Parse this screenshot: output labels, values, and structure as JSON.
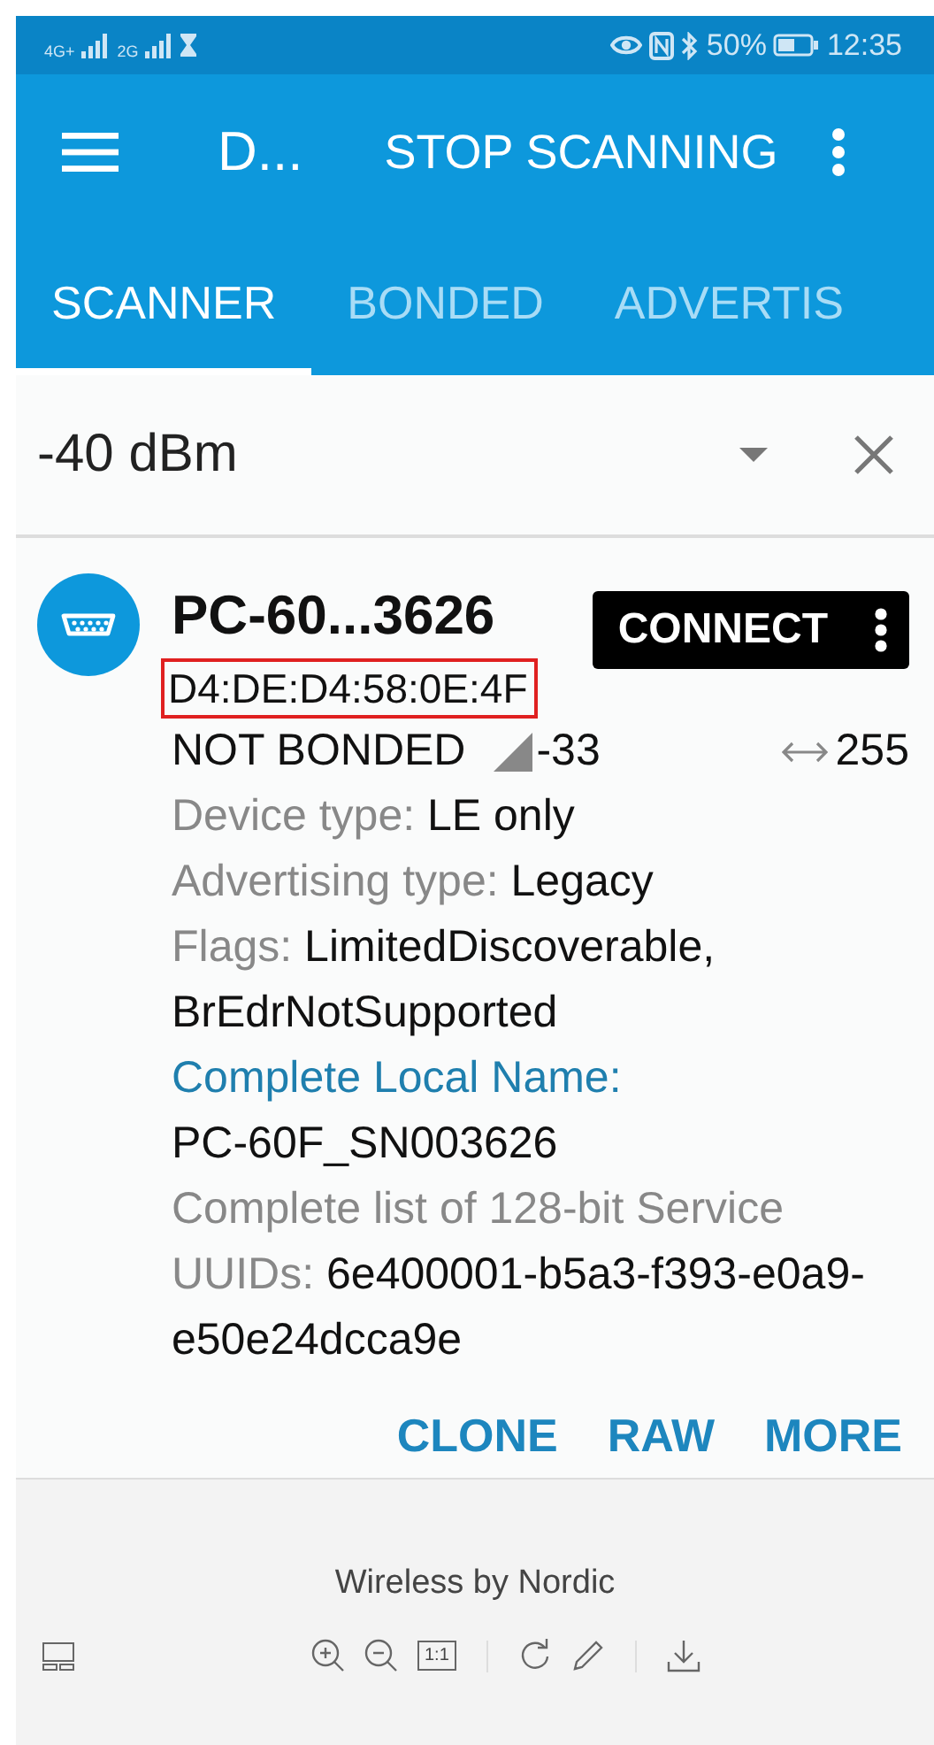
{
  "status_bar": {
    "network_1": "4G+",
    "network_2": "2G",
    "battery": "50%",
    "time": "12:35"
  },
  "toolbar": {
    "title": "D...",
    "action": "STOP SCANNING"
  },
  "tabs": [
    {
      "label": "SCANNER",
      "selected": true
    },
    {
      "label": "BONDED",
      "selected": false
    },
    {
      "label": "ADVERTIS",
      "selected": false
    }
  ],
  "filter": {
    "value": "-40 dBm"
  },
  "device": {
    "name": "PC-60...3626",
    "address": "D4:DE:D4:58:0E:4F",
    "address_highlighted": true,
    "connect": "CONNECT",
    "bond_state": "NOT BONDED",
    "rssi": "-33",
    "interval": "255",
    "details": [
      {
        "kind": "inline",
        "label": "Device type:",
        "value": "LE only"
      },
      {
        "kind": "inline",
        "label": "Advertising type:",
        "value": "Legacy"
      },
      {
        "kind": "inline",
        "label": "Flags:",
        "value": "LimitedDiscoverable, BrEdrNotSupported"
      },
      {
        "kind": "section",
        "label": "Complete Local Name:",
        "value": "PC-60F_SN003626"
      },
      {
        "kind": "inline",
        "label": "Complete list of 128-bit Service UUIDs:",
        "value": "6e400001-b5a3-f393-e0a9-e50e24dcca9e"
      }
    ],
    "actions": [
      "CLONE",
      "RAW",
      "MORE"
    ]
  },
  "footer": {
    "caption": "Wireless by Nordic",
    "actual_size": "1:1"
  }
}
